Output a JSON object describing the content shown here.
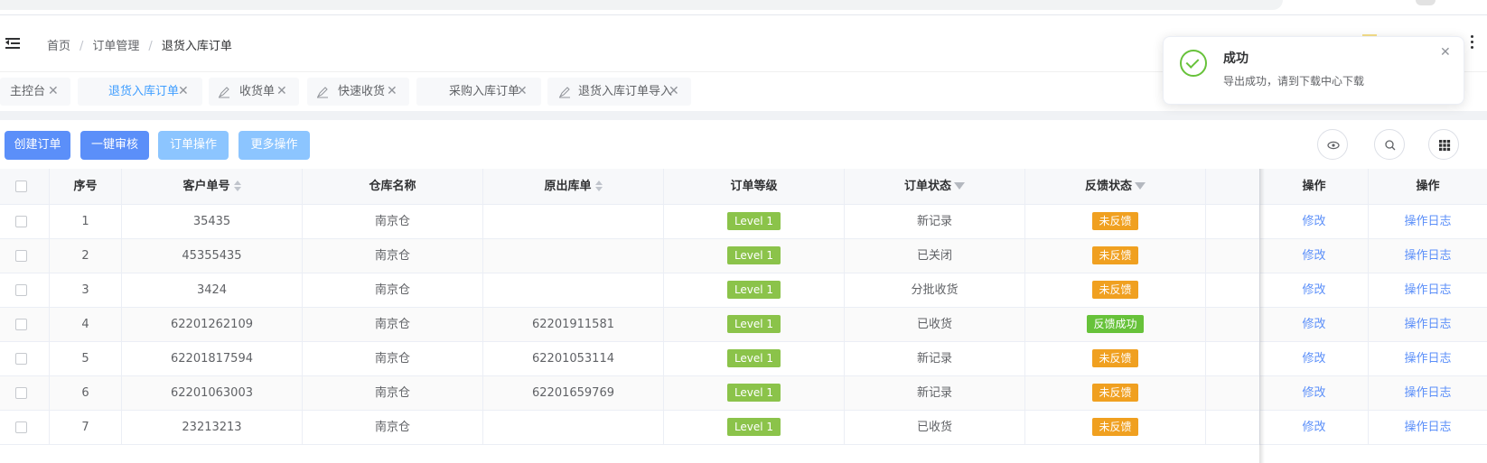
{
  "breadcrumb": {
    "home": "首页",
    "section": "订单管理",
    "current": "退货入库订单"
  },
  "tabs": [
    {
      "label": "主控台",
      "icon": ""
    },
    {
      "label": "退货入库订单",
      "icon": ""
    },
    {
      "label": "收货单",
      "icon": "edit-icon"
    },
    {
      "label": "快速收货",
      "icon": "edit-icon"
    },
    {
      "label": "采购入库订单",
      "icon": ""
    },
    {
      "label": "退货入库订单导入",
      "icon": "edit-icon"
    }
  ],
  "active_tab": "退货入库订单",
  "toolbar": {
    "create": "创建订单",
    "audit": "一键审核",
    "order_ops": "订单操作",
    "more_ops": "更多操作"
  },
  "table": {
    "headers": {
      "index": "序号",
      "customer_no": "客户单号",
      "warehouse": "仓库名称",
      "orig_out": "原出库单",
      "level": "订单等级",
      "status": "订单状态",
      "feedback": "反馈状态",
      "op1": "操作",
      "op2": "操作"
    },
    "rows": [
      {
        "index": "1",
        "customer_no": "35435",
        "warehouse": "南京仓",
        "orig_out": "",
        "level": "Level 1",
        "status": "新记录",
        "feedback": "未反馈",
        "edit": "修改",
        "log": "操作日志"
      },
      {
        "index": "2",
        "customer_no": "45355435",
        "warehouse": "南京仓",
        "orig_out": "",
        "level": "Level 1",
        "status": "已关闭",
        "feedback": "未反馈",
        "edit": "修改",
        "log": "操作日志"
      },
      {
        "index": "3",
        "customer_no": "3424",
        "warehouse": "南京仓",
        "orig_out": "",
        "level": "Level 1",
        "status": "分批收货",
        "feedback": "未反馈",
        "edit": "修改",
        "log": "操作日志"
      },
      {
        "index": "4",
        "customer_no": "62201262109",
        "warehouse": "南京仓",
        "orig_out": "62201911581",
        "level": "Level 1",
        "status": "已收货",
        "feedback": "反馈成功",
        "edit": "修改",
        "log": "操作日志"
      },
      {
        "index": "5",
        "customer_no": "62201817594",
        "warehouse": "南京仓",
        "orig_out": "62201053114",
        "level": "Level 1",
        "status": "新记录",
        "feedback": "未反馈",
        "edit": "修改",
        "log": "操作日志"
      },
      {
        "index": "6",
        "customer_no": "62201063003",
        "warehouse": "南京仓",
        "orig_out": "62201659769",
        "level": "Level 1",
        "status": "新记录",
        "feedback": "未反馈",
        "edit": "修改",
        "log": "操作日志"
      },
      {
        "index": "7",
        "customer_no": "23213213",
        "warehouse": "南京仓",
        "orig_out": "",
        "level": "Level 1",
        "status": "已收货",
        "feedback": "未反馈",
        "edit": "修改",
        "log": "操作日志"
      }
    ]
  },
  "notification": {
    "title": "成功",
    "message": "导出成功，请到下载中心下载"
  },
  "colors": {
    "primary": "#5b8ff9",
    "light_primary": "#8cc5ff",
    "level_badge": "#8bc34a",
    "feedback_pending": "#f0a020",
    "feedback_success": "#67c23a"
  }
}
